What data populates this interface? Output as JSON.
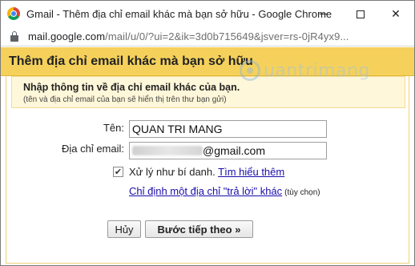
{
  "window": {
    "title": "Gmail - Thêm địa chỉ email khác mà bạn sở hữu - Google Chrome",
    "url_host": "mail.google.com",
    "url_path": "/mail/u/0/?ui=2&ik=3d0b715649&jsver=rs-0jR4yx9..."
  },
  "dialog": {
    "title": "Thêm địa chỉ email khác mà bạn sở hữu",
    "info_main": "Nhập thông tin về địa chỉ email khác của bạn.",
    "info_sub": "(tên và địa chỉ email của bạn sẽ hiển thị trên thư bạn gửi)",
    "watermark": "uantrimang"
  },
  "form": {
    "name_label": "Tên:",
    "name_value": "QUAN TRI MANG",
    "email_label": "Địa chỉ email:",
    "email_value_visible": "@gmail.com",
    "alias_checked": true,
    "alias_label": "Xử lý như bí danh.",
    "learn_more": "Tìm hiểu thêm",
    "reply_to_link": "Chỉ định một địa chỉ \"trả lời\" khác",
    "optional": "(tùy chọn)"
  },
  "buttons": {
    "cancel": "Hủy",
    "next": "Bước tiếp theo »"
  }
}
